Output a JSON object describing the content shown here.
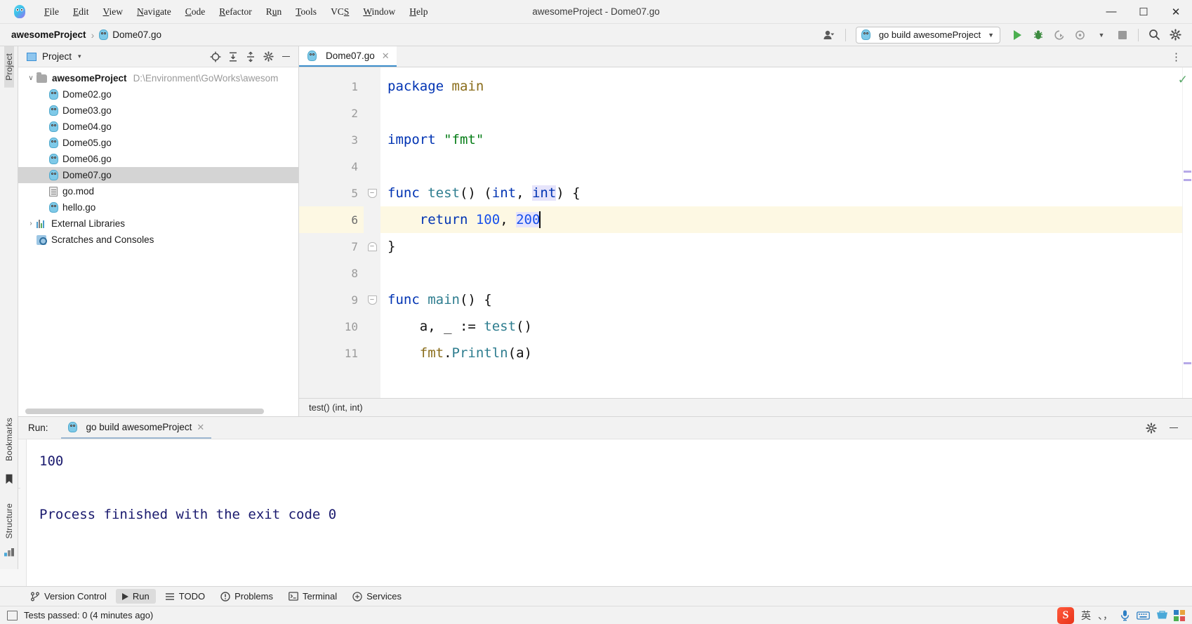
{
  "window": {
    "title": "awesomeProject - Dome07.go",
    "minimize": "—",
    "maximize": "☐",
    "close": "✕"
  },
  "menubar": {
    "items": [
      {
        "label": "File",
        "mnemonic": "F"
      },
      {
        "label": "Edit",
        "mnemonic": "E"
      },
      {
        "label": "View",
        "mnemonic": "V"
      },
      {
        "label": "Navigate",
        "mnemonic": "N"
      },
      {
        "label": "Code",
        "mnemonic": "C"
      },
      {
        "label": "Refactor",
        "mnemonic": "R"
      },
      {
        "label": "Run",
        "mnemonic": "u"
      },
      {
        "label": "Tools",
        "mnemonic": "T"
      },
      {
        "label": "VCS",
        "mnemonic": "S"
      },
      {
        "label": "Window",
        "mnemonic": "W"
      },
      {
        "label": "Help",
        "mnemonic": "H"
      }
    ]
  },
  "navbar": {
    "breadcrumb": {
      "project": "awesomeProject",
      "separator": "›",
      "file": "Dome07.go"
    },
    "run_config": "go build awesomeProject",
    "icons": {
      "account": "account-icon",
      "caret": "▾",
      "run": "run-icon",
      "debug": "debug-icon",
      "coverage": "coverage-icon",
      "profile": "profile-icon",
      "stop": "stop-icon",
      "search": "⚲",
      "settings": "⚙"
    }
  },
  "left_strip": {
    "labels": [
      "Project"
    ]
  },
  "left_strip_bottom": {
    "labels": [
      "Bookmarks",
      "Structure"
    ]
  },
  "project_panel": {
    "title": "Project",
    "dropdown_caret": "▾",
    "header_icons": [
      "locate-icon",
      "expand-all-icon",
      "collapse-all-icon",
      "gear-icon",
      "hide-icon"
    ],
    "tree": [
      {
        "label": "awesomeProject",
        "path": "D:\\Environment\\GoWorks\\awesom",
        "arrow": "∨",
        "icon": "folder-icon",
        "bold": true,
        "indent": 0,
        "selected": false
      },
      {
        "label": "Dome02.go",
        "path": "",
        "arrow": "",
        "icon": "go-file-icon",
        "bold": false,
        "indent": 1,
        "selected": false
      },
      {
        "label": "Dome03.go",
        "path": "",
        "arrow": "",
        "icon": "go-file-icon",
        "bold": false,
        "indent": 1,
        "selected": false
      },
      {
        "label": "Dome04.go",
        "path": "",
        "arrow": "",
        "icon": "go-file-icon",
        "bold": false,
        "indent": 1,
        "selected": false
      },
      {
        "label": "Dome05.go",
        "path": "",
        "arrow": "",
        "icon": "go-file-icon",
        "bold": false,
        "indent": 1,
        "selected": false
      },
      {
        "label": "Dome06.go",
        "path": "",
        "arrow": "",
        "icon": "go-file-icon",
        "bold": false,
        "indent": 1,
        "selected": false
      },
      {
        "label": "Dome07.go",
        "path": "",
        "arrow": "",
        "icon": "go-file-icon",
        "bold": false,
        "indent": 1,
        "selected": true
      },
      {
        "label": "go.mod",
        "path": "",
        "arrow": "",
        "icon": "mod-file-icon",
        "bold": false,
        "indent": 1,
        "selected": false
      },
      {
        "label": "hello.go",
        "path": "",
        "arrow": "",
        "icon": "go-file-icon",
        "bold": false,
        "indent": 1,
        "selected": false
      },
      {
        "label": "External Libraries",
        "path": "",
        "arrow": "›",
        "icon": "library-icon",
        "bold": false,
        "indent": 0,
        "selected": false
      },
      {
        "label": "Scratches and Consoles",
        "path": "",
        "arrow": "",
        "icon": "scratch-icon",
        "bold": false,
        "indent": 0,
        "selected": false
      }
    ]
  },
  "editor": {
    "tab": {
      "label": "Dome07.go",
      "close": "✕"
    },
    "overflow_menu": "⋮",
    "breadcrumb_status": "test() (int, int)",
    "inspection_ok": "✓",
    "lines": [
      {
        "num": "1",
        "current": false,
        "fold": "open-start",
        "run_marker": false,
        "tokens": [
          {
            "t": "package",
            "c": "kw"
          },
          {
            "t": " ",
            "c": "plain"
          },
          {
            "t": "main",
            "c": "pkg"
          }
        ]
      },
      {
        "num": "2",
        "current": false,
        "fold": "",
        "run_marker": false,
        "tokens": []
      },
      {
        "num": "3",
        "current": false,
        "fold": "",
        "run_marker": false,
        "tokens": [
          {
            "t": "import",
            "c": "kw"
          },
          {
            "t": " ",
            "c": "plain"
          },
          {
            "t": "\"fmt\"",
            "c": "str"
          }
        ]
      },
      {
        "num": "4",
        "current": false,
        "fold": "",
        "run_marker": false,
        "tokens": []
      },
      {
        "num": "5",
        "current": false,
        "fold": "open",
        "run_marker": false,
        "tokens": [
          {
            "t": "func",
            "c": "kw"
          },
          {
            "t": " ",
            "c": "plain"
          },
          {
            "t": "test",
            "c": "fn"
          },
          {
            "t": "() (",
            "c": "plain"
          },
          {
            "t": "int",
            "c": "typ"
          },
          {
            "t": ", ",
            "c": "plain"
          },
          {
            "t": "int",
            "c": "typ hl"
          },
          {
            "t": ") {",
            "c": "plain"
          }
        ]
      },
      {
        "num": "6",
        "current": true,
        "fold": "",
        "run_marker": false,
        "tokens": [
          {
            "t": "    ",
            "c": "plain"
          },
          {
            "t": "return",
            "c": "kw"
          },
          {
            "t": " ",
            "c": "plain"
          },
          {
            "t": "100",
            "c": "num"
          },
          {
            "t": ", ",
            "c": "plain"
          },
          {
            "t": "200",
            "c": "num hl"
          },
          {
            "t": "|caret|",
            "c": "caret"
          }
        ]
      },
      {
        "num": "7",
        "current": false,
        "fold": "close",
        "run_marker": false,
        "tokens": [
          {
            "t": "}",
            "c": "plain"
          }
        ]
      },
      {
        "num": "8",
        "current": false,
        "fold": "",
        "run_marker": false,
        "tokens": []
      },
      {
        "num": "9",
        "current": false,
        "fold": "open",
        "run_marker": true,
        "tokens": [
          {
            "t": "func",
            "c": "kw"
          },
          {
            "t": " ",
            "c": "plain"
          },
          {
            "t": "main",
            "c": "fn"
          },
          {
            "t": "() {",
            "c": "plain"
          }
        ]
      },
      {
        "num": "10",
        "current": false,
        "fold": "",
        "run_marker": false,
        "tokens": [
          {
            "t": "    a, _ := ",
            "c": "plain"
          },
          {
            "t": "test",
            "c": "fn"
          },
          {
            "t": "()",
            "c": "plain"
          }
        ]
      },
      {
        "num": "11",
        "current": false,
        "fold": "",
        "run_marker": false,
        "tokens": [
          {
            "t": "    ",
            "c": "plain"
          },
          {
            "t": "fmt",
            "c": "pkg"
          },
          {
            "t": ".",
            "c": "plain"
          },
          {
            "t": "Println",
            "c": "fn"
          },
          {
            "t": "(a)",
            "c": "plain"
          }
        ]
      }
    ]
  },
  "run_window": {
    "label": "Run:",
    "tab": "go build awesomeProject",
    "tab_close": "✕",
    "header_icons": [
      "gear-icon",
      "hide-icon"
    ],
    "side_icons": [
      "rerun-icon",
      "wrench-icon",
      "stop-icon",
      "scroll-to-end-icon",
      "trash-icon",
      "more-icon"
    ],
    "console_lines": [
      "100",
      "",
      "Process finished with the exit code 0"
    ]
  },
  "bottom_toolbar": {
    "items": [
      {
        "label": "Version Control",
        "icon": "branch-icon",
        "active": false
      },
      {
        "label": "Run",
        "icon": "run-icon",
        "active": true
      },
      {
        "label": "TODO",
        "icon": "todo-icon",
        "active": false
      },
      {
        "label": "Problems",
        "icon": "problems-icon",
        "active": false
      },
      {
        "label": "Terminal",
        "icon": "terminal-icon",
        "active": false
      },
      {
        "label": "Services",
        "icon": "services-icon",
        "active": false
      }
    ]
  },
  "statusbar": {
    "message": "Tests passed: 0 (4 minutes ago)",
    "ime": {
      "logo": "S",
      "mode": "英",
      "punct": "、，",
      "mic": "mic-icon",
      "keyboard": "keyboard-icon",
      "tools": "tools-icon",
      "apps": "apps-icon"
    }
  }
}
